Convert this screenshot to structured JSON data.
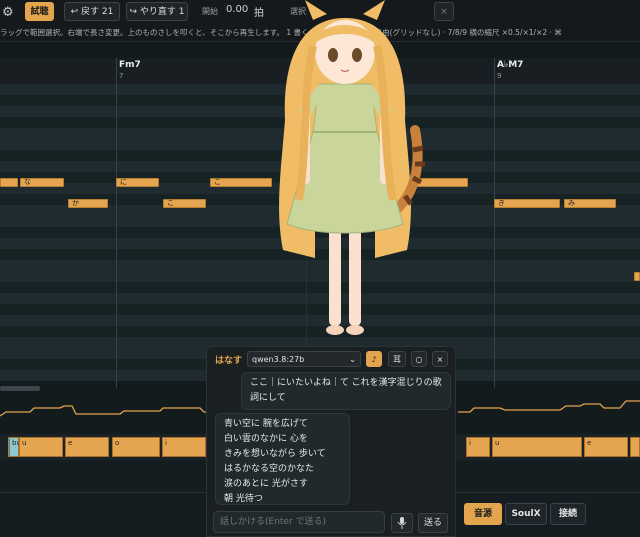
{
  "toolbar": {
    "gear_icon": "gear-icon",
    "practice_label": "試聴 on",
    "undo_label": "↩ 戻す 21",
    "redo_label": "↪ やり直す 1",
    "start_label": "開始",
    "time_value": "0.00",
    "beat_unit": "拍",
    "select_label": "選択",
    "close_glyph": "×"
  },
  "hint": "ラッグで範囲選択。右端で長さ変更。上のものさしを叩くと、そこから再生します。                                   1 書く · 2 範囲で選ぶ · 3 自由(グリッドなし) · 7/8/9 横の縮尺 ×0.5/×1/×2 · ⌘",
  "ruler": {
    "chords": [
      "Fm7",
      "A♭M7"
    ],
    "bars": [
      "7",
      "9"
    ]
  },
  "notes": [
    "な",
    "に",
    "こ",
    "か",
    "こ",
    "き",
    "み"
  ],
  "strip_notes": [
    "bu",
    "u",
    "e",
    "o",
    "i",
    "i",
    "u",
    "e",
    "o",
    "i"
  ],
  "chat": {
    "title": "はなす",
    "model": "qwen3.8:27b",
    "music_icon": "♪",
    "ear_label": "耳",
    "minimize_label": "○",
    "close_label": "×",
    "user_message": "ここ｜にいたいよね｜て これを漢字混じりの歌詞にして",
    "assistant_lines": [
      "青い空に 腕を広げて",
      "白い雲のなかに 心を",
      "きみを想いながら 歩いて",
      "はるかなる空のかなた",
      "涙のあとに 光がさす",
      "朝 光待つ"
    ],
    "input_placeholder": "話しかける(Enter で送る)",
    "mic_icon": "mic-icon",
    "send_label": "送る"
  },
  "bottom_buttons": [
    "音源",
    "SoulX",
    "接続"
  ],
  "colors": {
    "accent": "#e4a450",
    "background": "#121b1c"
  }
}
